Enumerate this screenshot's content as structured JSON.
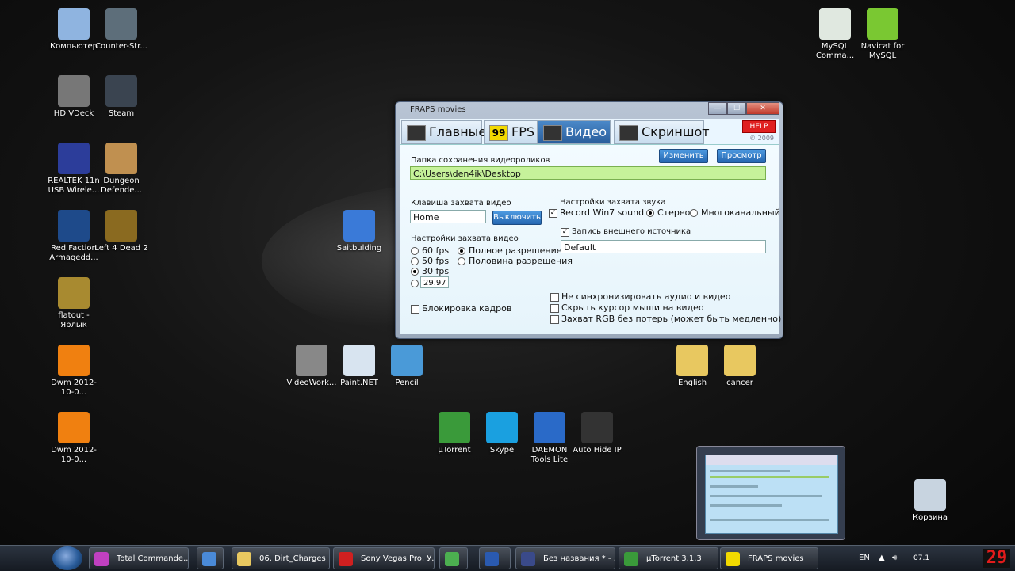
{
  "desktop_icons": [
    {
      "label": "Компьютер",
      "icon": "computer-icon",
      "color": "#8fb4e0"
    },
    {
      "label": "Counter-Str...",
      "icon": "counter-strike-icon",
      "color": "#5d6e7a"
    },
    {
      "label": "HD VDeck",
      "icon": "hd-vdeck-icon",
      "color": "#777777"
    },
    {
      "label": "Steam",
      "icon": "steam-icon",
      "color": "#3a4450"
    },
    {
      "label": "REALTEK 11n USB Wirele...",
      "icon": "realtek-icon",
      "color": "#2c3d9a"
    },
    {
      "label": "Dungeon Defende...",
      "icon": "dungeon-defenders-icon",
      "color": "#c09050"
    },
    {
      "label": "Red Faction Armagedd...",
      "icon": "red-faction-icon",
      "color": "#1e4a8a"
    },
    {
      "label": "Left 4 Dead 2",
      "icon": "left4dead-icon",
      "color": "#8a6a20"
    },
    {
      "label": "flatout - Ярлык",
      "icon": "flatout-icon",
      "color": "#a88a30"
    },
    {
      "label": "Dwm 2012-10-0...",
      "icon": "vlc-icon",
      "color": "#f08010"
    },
    {
      "label": "Dwm 2012-10-0...",
      "icon": "vlc-icon",
      "color": "#f08010"
    },
    {
      "label": "MySQL Comma...",
      "icon": "mysql-icon",
      "color": "#e0e8e0"
    },
    {
      "label": "Navicat for MySQL",
      "icon": "navicat-icon",
      "color": "#7ac832"
    },
    {
      "label": "Saitbulding",
      "icon": "monitor-icon",
      "color": "#3a7ad8"
    },
    {
      "label": "VideoWork...",
      "icon": "camera-icon",
      "color": "#888888"
    },
    {
      "label": "Paint.NET",
      "icon": "paintnet-icon",
      "color": "#d8e4f0"
    },
    {
      "label": "Pencil",
      "icon": "pencil-icon",
      "color": "#4a9ad8"
    },
    {
      "label": "English",
      "icon": "folder-icon",
      "color": "#e8c860"
    },
    {
      "label": "cancer",
      "icon": "folder-icon",
      "color": "#e8c860"
    },
    {
      "label": "µTorrent",
      "icon": "utorrent-icon",
      "color": "#3a9a3a"
    },
    {
      "label": "Skype",
      "icon": "skype-icon",
      "color": "#1aa0e0"
    },
    {
      "label": "DAEMON Tools Lite",
      "icon": "daemon-tools-icon",
      "color": "#2a6ac8"
    },
    {
      "label": "Auto Hide IP",
      "icon": "auto-hide-ip-icon",
      "color": "#333333"
    },
    {
      "label": "Корзина",
      "icon": "recycle-bin-icon",
      "color": "#c8d4e0"
    }
  ],
  "window": {
    "title": "FRAPS movies",
    "min": "—",
    "max": "☐",
    "close": "✕",
    "help": "HELP",
    "version": "© 2009",
    "tabs": [
      "Главные",
      "FPS",
      "Видео",
      "Скриншот"
    ],
    "fps_tab_icon_text": "99",
    "folder_label": "Папка сохранения видеороликов",
    "change_btn": "Изменить",
    "view_btn": "Просмотр",
    "folder_path": "C:\\Users\\den4ik\\Desktop",
    "hotkey_label": "Клавиша захвата видео",
    "hotkey_value": "Home",
    "disable_btn": "Выключить",
    "video_settings_label": "Настройки захвата видео",
    "fps_options": [
      "60 fps",
      "50 fps",
      "30 fps"
    ],
    "custom_fps": "29.97",
    "res_full": "Полное разрешение",
    "res_half": "Половина разрешения",
    "lock_frames": "Блокировка кадров",
    "sound_settings_label": "Настройки захвата звука",
    "record_win7": "Record Win7 sound",
    "stereo": "Стерео",
    "multichannel": "Многоканальный",
    "external_source": "Запись внешнего источника",
    "external_device": "Default",
    "opt_nosync": "Не синхронизировать аудио и видео",
    "opt_hide_cursor": "Скрыть курсор мыши на видео",
    "opt_rgb": "Захват RGB без потерь (может быть медленно)"
  },
  "taskbar": {
    "items": [
      {
        "label": "Total Commande...",
        "icon": "total-commander-icon",
        "color": "#c040c0"
      },
      {
        "label": "",
        "icon": "globe-icon",
        "color": "#4a8ad8"
      },
      {
        "label": "06. Dirt_Charges",
        "icon": "folder-icon",
        "color": "#e8c860"
      },
      {
        "label": "Sony Vegas Pro, У...",
        "icon": "opera-icon",
        "color": "#d02020"
      },
      {
        "label": "",
        "icon": "chrome-icon",
        "color": "#4caf50"
      },
      {
        "label": "",
        "icon": "word-icon",
        "color": "#2a5ab0"
      },
      {
        "label": "Без названия * - ...",
        "icon": "vegas-icon",
        "color": "#3a4a8a"
      },
      {
        "label": "µTorrent 3.1.3",
        "icon": "utorrent-icon",
        "color": "#3a9a3a"
      },
      {
        "label": "FRAPS movies",
        "icon": "fraps-icon",
        "color": "#f2d900"
      }
    ],
    "lang": "EN",
    "clock_date": "07.1",
    "counter": "29"
  }
}
